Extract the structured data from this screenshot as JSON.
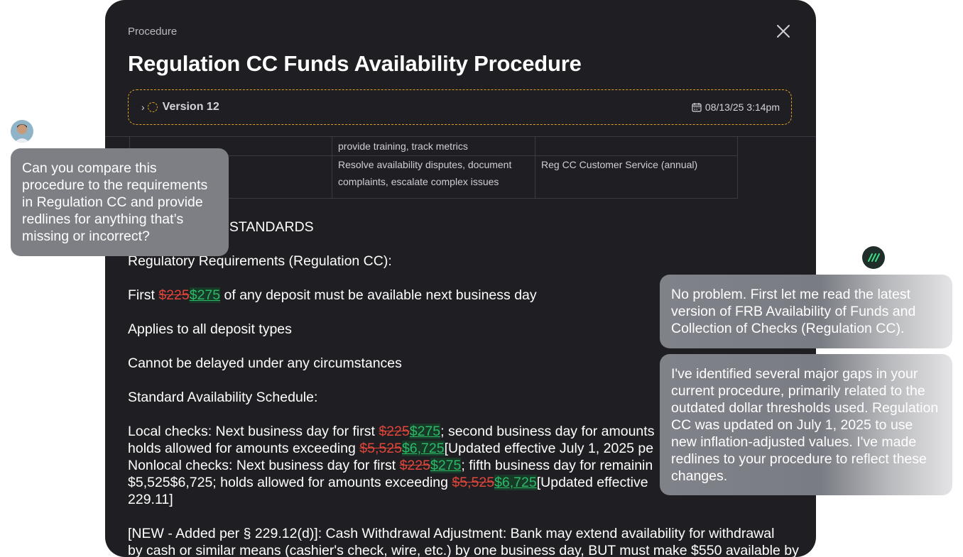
{
  "modal": {
    "kicker": "Procedure",
    "title": "Regulation CC Funds Availability Procedure",
    "version": {
      "label": "Version 12",
      "date": "08/13/25 3:14pm",
      "accent": "#e0a020"
    }
  },
  "table": {
    "rows": [
      {
        "col1": "",
        "col2": "provide training, track metrics",
        "col3": ""
      },
      {
        "col1": "",
        "col2": "Resolve availability disputes, document complaints, escalate complex issues",
        "col3": "Reg CC Customer Service (annual)"
      }
    ]
  },
  "doc": {
    "heading_fragment": "S & STANDARDS",
    "reg_req": "Regulatory Requirements (Regulation CC):",
    "first_pre": "First ",
    "first_del": "$225",
    "first_ins": "$275",
    "first_post": " of any deposit must be available next business day",
    "applies": "Applies to all deposit types",
    "cannot": "Cannot be delayed under any circumstances",
    "std_sched": "Standard Availability Schedule:",
    "local1_pre": "Local checks: Next business day for first ",
    "local1_del": "$225",
    "local1_ins": "$275",
    "local1_post": "; second business day for amounts",
    "local2_pre": "holds allowed for amounts exceeding ",
    "local2_del": "$5,525",
    "local2_ins": "$6,725",
    "local2_post": "[Updated effective July 1, 2025 pe",
    "nonlocal1_pre": "Nonlocal checks: Next business day for first ",
    "nonlocal1_del": "$225",
    "nonlocal1_ins": "$275",
    "nonlocal1_post": "; fifth business day for remainin",
    "nonlocal2_pre": "$5,525$6,725; holds allowed for amounts exceeding ",
    "nonlocal2_del": "$5,525",
    "nonlocal2_ins": "$6,725",
    "nonlocal2_post": "[Updated effective",
    "nonlocal3": "229.11]",
    "new1": "[NEW - Added per § 229.12(d)]: Cash Withdrawal Adjustment: Bank may extend availability for withdrawal",
    "new2": "by cash or similar means (cashier's check, wire, etc.) by one business day, BUT must make $550 available by"
  },
  "chat": {
    "user_message": "Can you compare this procedure to the requirements in Regulation CC and provide redlines for anything that’s missing or incorrect?",
    "ai_message_1": "No problem. First let me read the latest version of FRB Availability of Funds and Collection of Checks (Regulation CC).",
    "ai_message_2": "I've identified several major gaps in your current procedure, primarily related to the outdated dollar thresholds used. Regulation CC was updated on July 1, 2025 to use new inflation-adjusted values. I've made redlines to your procedure to reflect these changes."
  },
  "colors": {
    "deleted": "#e0453a",
    "inserted": "#2fb86a",
    "modal_bg": "#1f1f23"
  },
  "icons": {
    "close": "close-icon",
    "chevron": "chevron-right-icon",
    "status": "spinner-icon",
    "calendar": "calendar-icon",
    "ai_logo": "ai-logo-icon"
  }
}
